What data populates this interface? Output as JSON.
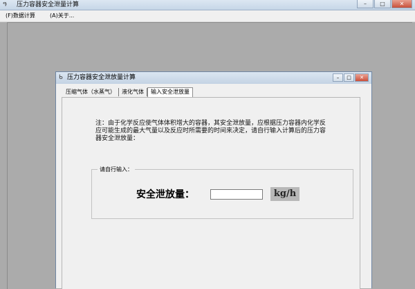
{
  "main_window": {
    "icon": "app-icon",
    "title": "压力容器安全泄量计算",
    "controls": {
      "minimize": "–",
      "maximize": "□",
      "close": "✕"
    }
  },
  "menubar": {
    "items": [
      "(F)数据计算",
      "(A)关于..."
    ]
  },
  "child_window": {
    "icon": "window-icon",
    "title": "压力容器安全泄放量计算",
    "controls": {
      "minimize": "–",
      "maximize": "□",
      "close": "✕"
    }
  },
  "tabs": [
    {
      "label": "压缩气体（水蒸气）",
      "active": false
    },
    {
      "label": "液化气体",
      "active": false
    },
    {
      "label": "输入安全泄放量",
      "active": true
    }
  ],
  "notice": {
    "text": "注：由于化学反应使气体体积增大的容器，其安全泄放量，应根据压力容器内化学反应可能生成的最大气量以及反应时所需要的时间来决定，请自行输入计算后的压力容器安全泄放量："
  },
  "input_group": {
    "legend": "请自行输入：",
    "label": "安全泄放量：",
    "value": "",
    "unit": "kg/h"
  }
}
